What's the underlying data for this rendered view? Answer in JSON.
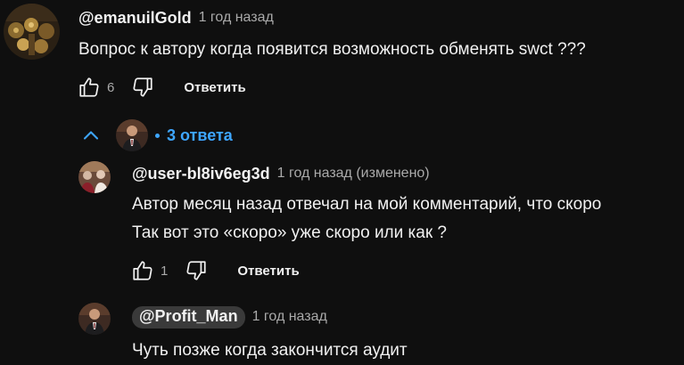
{
  "colors": {
    "background": "#0f0f0f",
    "text": "#f1f1f1",
    "secondary_text": "#aaaaaa",
    "accent": "#3ea6ff"
  },
  "comment": {
    "author": "@emanuilGold",
    "time": "1 год назад",
    "text": "Вопрос к автору когда появится возможность обменять swct ???",
    "likes": "6",
    "reply_label": "Ответить"
  },
  "replies_toggle": {
    "count_label": "3 ответа",
    "chevron_icon": "chevron-up-icon"
  },
  "replies": [
    {
      "author": "@user-bl8iv6eg3d",
      "time": "1 год назад (изменено)",
      "text_lines": [
        "Автор месяц назад отвечал на мой комментарий, что скоро",
        "Так вот это «скоро» уже скоро или как ?"
      ],
      "likes": "1",
      "reply_label": "Ответить"
    },
    {
      "author": "@Profit_Man",
      "time": "1 год назад",
      "text_lines": [
        "Чуть позже когда закончится аудит"
      ]
    }
  ]
}
